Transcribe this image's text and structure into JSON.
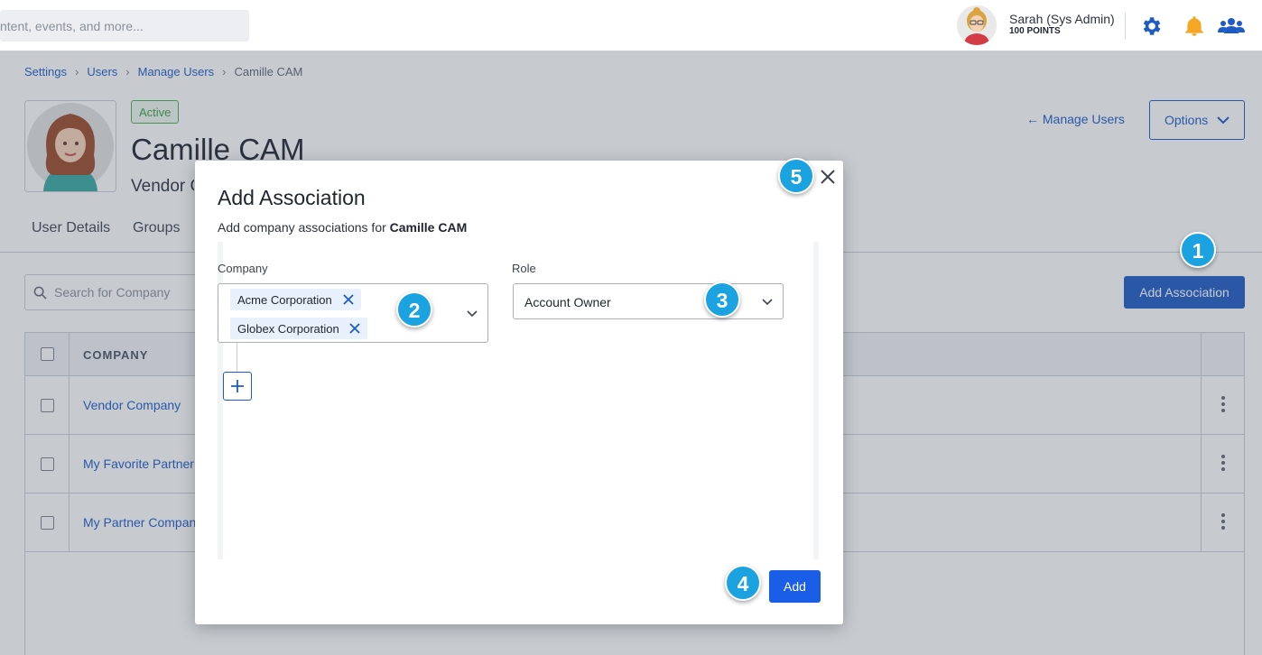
{
  "topbar": {
    "search_placeholder": "ntent, events, and more...",
    "user_name": "Sarah (Sys Admin)",
    "user_points": "100 POINTS",
    "icons": [
      "settings-icon",
      "notification-bell-icon",
      "people-icon"
    ],
    "colors": {
      "settings": "#1f5bc4",
      "bell": "#f5a623",
      "people": "#1f5bc4"
    }
  },
  "breadcrumb": {
    "items": [
      "Settings",
      "Users",
      "Manage Users"
    ],
    "current": "Camille CAM"
  },
  "profile": {
    "status": "Active",
    "name": "Camille CAM",
    "company_partial": "Vendor C"
  },
  "header_actions": {
    "back_link": "← Manage Users",
    "options": "Options"
  },
  "tabs": [
    "User Details",
    "Groups"
  ],
  "search": {
    "placeholder": "Search for Company"
  },
  "add_association_button": "Add Association",
  "table": {
    "column_header": "COMPANY",
    "rows": [
      "Vendor Company",
      "My Favorite Partner",
      "My Partner Compan"
    ]
  },
  "modal": {
    "title": "Add Association",
    "description_prefix": "Add company associations for ",
    "description_user": "Camille CAM",
    "company_label": "Company",
    "role_label": "Role",
    "selected_companies": [
      "Acme Corporation",
      "Globex Corporation"
    ],
    "role_value": "Account Owner",
    "add_button": "Add"
  },
  "callouts": [
    "1",
    "2",
    "3",
    "4",
    "5"
  ],
  "colors": {
    "primary": "#1f5bc4",
    "callout": "#1ba2e0",
    "active_badge": "#4caf50"
  }
}
